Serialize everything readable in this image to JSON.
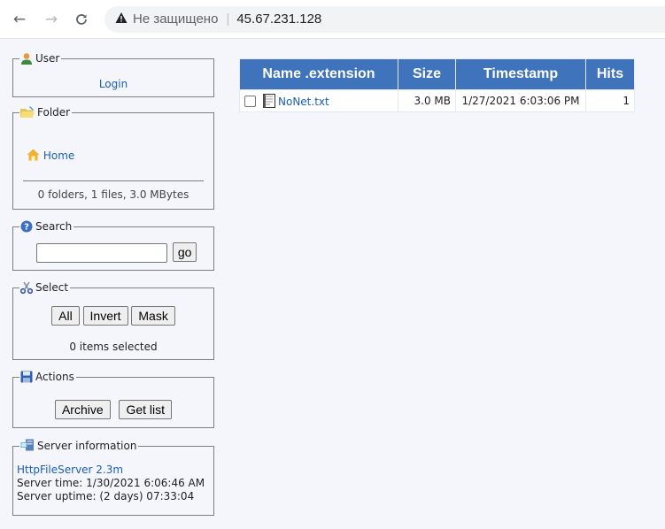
{
  "browser": {
    "security_label": "Не защищено",
    "url": "45.67.231.128"
  },
  "user_panel": {
    "title": "User",
    "login_label": "Login"
  },
  "folder_panel": {
    "title": "Folder",
    "home_label": "Home",
    "summary": "0 folders, 1 files, 3.0 MBytes"
  },
  "search_panel": {
    "title": "Search",
    "query": "",
    "go_label": "go"
  },
  "select_panel": {
    "title": "Select",
    "all_label": "All",
    "invert_label": "Invert",
    "mask_label": "Mask",
    "status": "0 items selected"
  },
  "actions_panel": {
    "title": "Actions",
    "archive_label": "Archive",
    "getlist_label": "Get list"
  },
  "server_panel": {
    "title": "Server information",
    "software": "HttpFileServer 2.3m",
    "time": "Server time: 1/30/2021 6:06:46 AM",
    "uptime": "Server uptime: (2 days) 07:33:04"
  },
  "files_table": {
    "columns": [
      "Name .extension",
      "Size",
      "Timestamp",
      "Hits"
    ],
    "rows": [
      {
        "name": "NoNet.txt",
        "size": "3.0 MB",
        "timestamp": "1/27/2021 6:03:06 PM",
        "hits": "1"
      }
    ]
  },
  "colors": {
    "header_blue": "#3f74bd",
    "link_blue": "#1a5fb4",
    "page_bg": "#f4f6fb"
  }
}
